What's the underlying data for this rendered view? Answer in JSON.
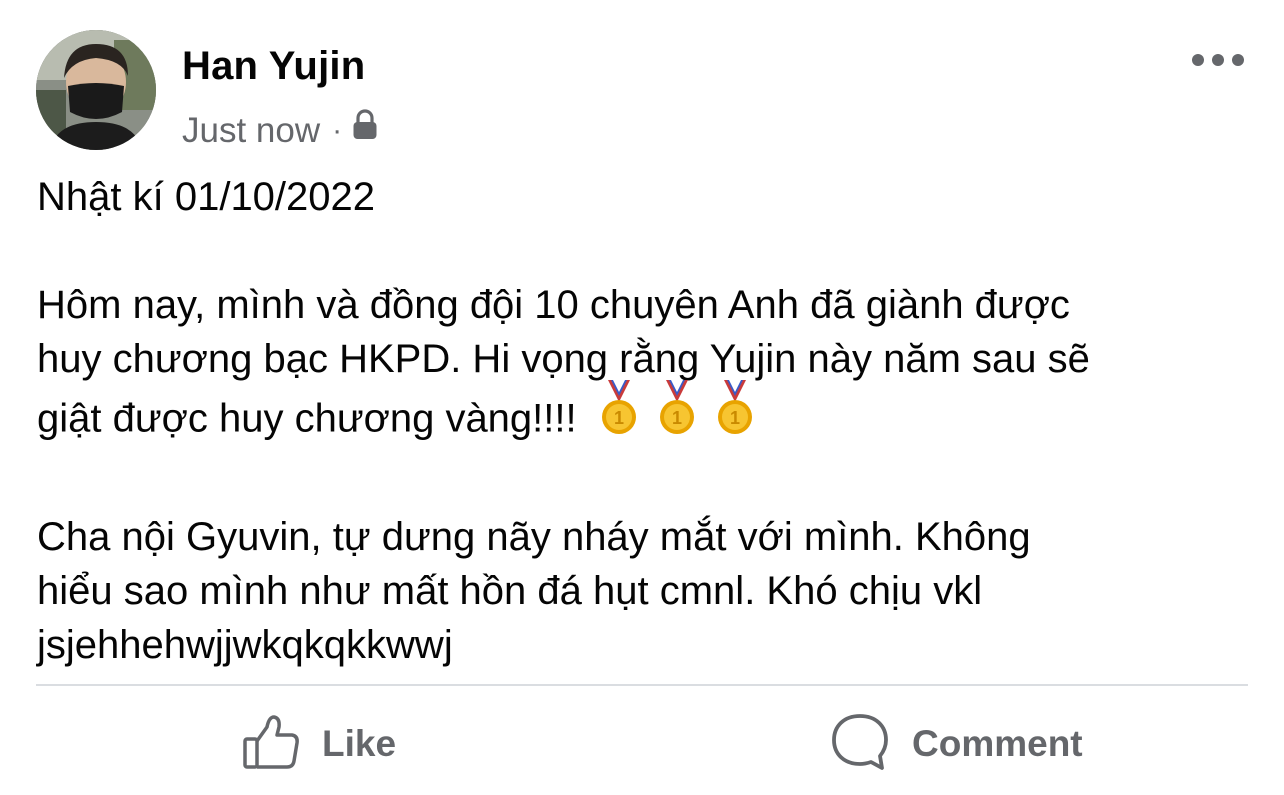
{
  "post": {
    "author": "Han Yujin",
    "timestamp": "Just now",
    "separator": "·",
    "privacy_icon": "lock-icon",
    "more_icon": "more-horizontal-icon",
    "title_line": "Nhật kí 01/10/2022",
    "paragraph1_line1": "Hôm nay, mình và đồng đội 10 chuyên Anh đã giành được",
    "paragraph1_line2": "huy chương bạc HKPD. Hi vọng rằng Yujin này năm sau sẽ",
    "paragraph1_line3": "giật được huy chương vàng!!!!",
    "emojis": [
      "1st-place-medal-icon",
      "1st-place-medal-icon",
      "1st-place-medal-icon"
    ],
    "paragraph2_line1": "Cha nội Gyuvin, tự dưng nãy nháy mắt với mình. Không",
    "paragraph2_line2": "hiểu sao mình như mất hồn đá hụt cmnl. Khó chịu vkl",
    "paragraph2_line3": "jsjehhehwjjwkqkqkkwwj"
  },
  "actions": {
    "like_label": "Like",
    "comment_label": "Comment"
  },
  "colors": {
    "text_primary": "#050505",
    "text_secondary": "#65676b",
    "divider": "#dadde1",
    "medal_gold": "#f2b600"
  }
}
